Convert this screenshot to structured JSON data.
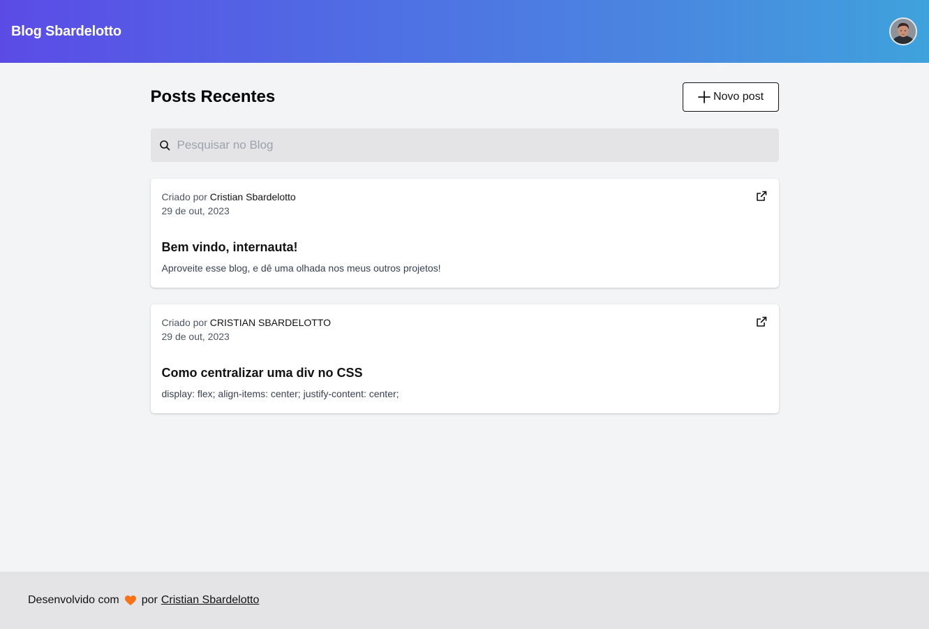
{
  "header": {
    "brand": "Blog Sbardelotto",
    "avatar_alt": "Cristian Sbardelotto avatar"
  },
  "main": {
    "title": "Posts Recentes",
    "new_post_label": "Novo post",
    "search_placeholder": "Pesquisar no Blog"
  },
  "posts": [
    {
      "created_by_label": "Criado por",
      "author": "Cristian Sbardelotto",
      "date": "29 de out, 2023",
      "title": "Bem vindo, internauta!",
      "excerpt": "Aproveite esse blog, e dê uma olhada nos meus outros projetos!"
    },
    {
      "created_by_label": "Criado por",
      "author": "CRISTIAN SBARDELOTTO",
      "date": "29 de out, 2023",
      "title": "Como centralizar uma div no CSS",
      "excerpt": "display: flex; align-items: center; justify-content: center;"
    }
  ],
  "footer": {
    "prefix": "Desenvolvido com",
    "by": "por",
    "author_link": "Cristian Sbardelotto"
  },
  "colors": {
    "header_gradient_start": "#5b4be6",
    "header_gradient_end": "#3fa2dc",
    "heart": "#f97316"
  },
  "icons": {
    "search": "search-icon",
    "plus": "plus-icon",
    "external": "external-link-icon",
    "heart": "heart-icon"
  }
}
